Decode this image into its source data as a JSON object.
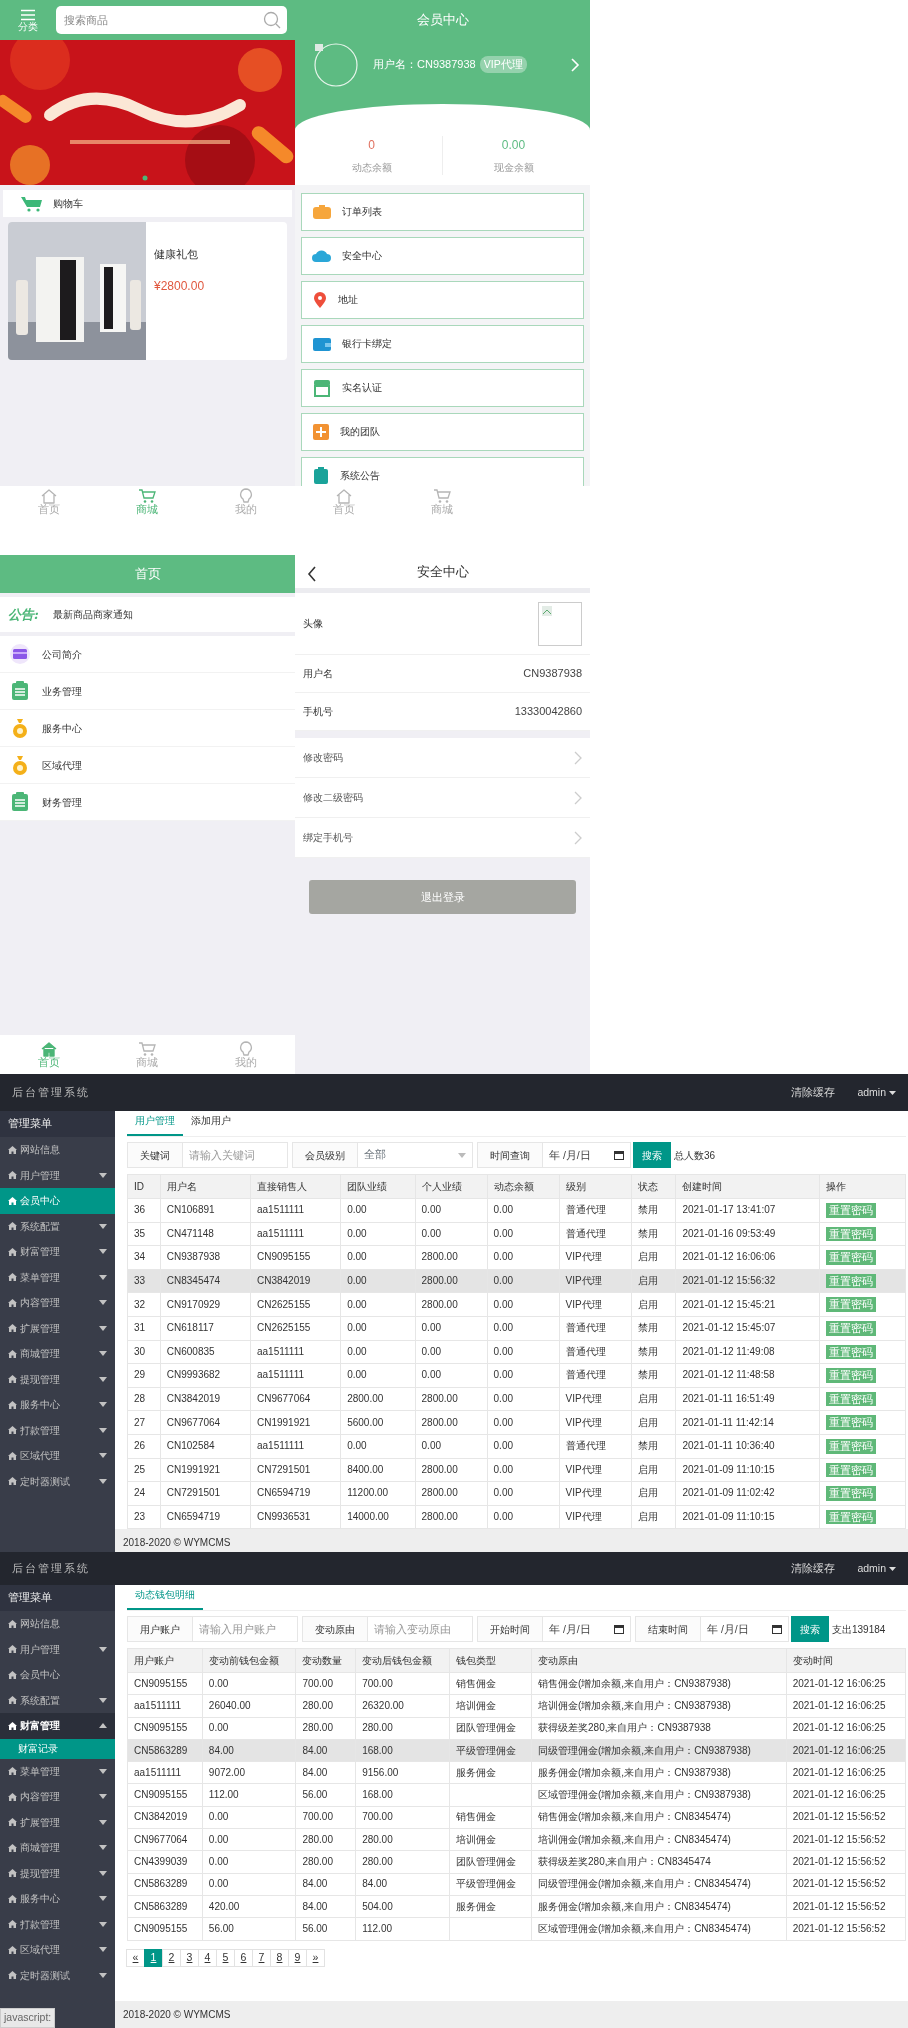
{
  "mall_screen": {
    "menu_label": "分类",
    "search": {
      "placeholder": "搜索商品"
    },
    "cart_label": "购物车",
    "products": [
      {
        "name": "健康礼包",
        "price": "¥2800.00"
      }
    ],
    "tab_bar": [
      {
        "label": "首页",
        "selected": false
      },
      {
        "label": "商城",
        "selected": true
      },
      {
        "label": "我的",
        "selected": false
      }
    ]
  },
  "member_screen": {
    "title": "会员中心",
    "username": "用户名：CN9387938",
    "badge": "VIP代理",
    "balances": [
      {
        "value": "0",
        "label": "动态余额",
        "color": "#e0705f"
      },
      {
        "value": "0.00",
        "label": "现金余额",
        "color": "#5dbb82"
      }
    ],
    "menu": [
      "订单列表",
      "安全中心",
      "地址",
      "银行卡绑定",
      "实名认证",
      "我的团队",
      "系统公告"
    ],
    "tab_bar": [
      {
        "label": "首页",
        "selected": false
      },
      {
        "label": "商城",
        "selected": false
      }
    ]
  },
  "home_screen": {
    "title": "首页",
    "notice_label": "公告:",
    "notice_text": "最新商品商家通知",
    "menu": [
      "公司简介",
      "业务管理",
      "服务中心",
      "区域代理",
      "财务管理"
    ],
    "tab_bar": [
      {
        "label": "首页",
        "selected": true
      },
      {
        "label": "商城",
        "selected": false
      },
      {
        "label": "我的",
        "selected": false
      }
    ]
  },
  "security_screen": {
    "title": "安全中心",
    "rows": [
      {
        "kind": "avatar",
        "label": "头像"
      },
      {
        "kind": "value",
        "label": "用户名",
        "value": "CN9387938"
      },
      {
        "kind": "value",
        "label": "手机号",
        "value": "13330042860"
      },
      {
        "kind": "link",
        "label": "修改密码"
      },
      {
        "kind": "link",
        "label": "修改二级密码"
      },
      {
        "kind": "link",
        "label": "绑定手机号"
      }
    ],
    "logout": "退出登录"
  },
  "user_admin": {
    "brand": "后台管理系统",
    "header_links": [
      "清除缓存",
      "admin"
    ],
    "sidebar": {
      "title": "管理菜单",
      "items": [
        {
          "label": "网站信息",
          "kind": "link",
          "selected": false
        },
        {
          "label": "用户管理",
          "kind": "group",
          "expanded": false,
          "selected": false
        },
        {
          "label": "会员中心",
          "kind": "link",
          "selected": true
        },
        {
          "label": "系统配置",
          "kind": "group",
          "expanded": false,
          "selected": false
        },
        {
          "label": "财富管理",
          "kind": "group",
          "expanded": false,
          "selected": false
        },
        {
          "label": "菜单管理",
          "kind": "group",
          "expanded": false,
          "selected": false
        },
        {
          "label": "内容管理",
          "kind": "group",
          "expanded": false,
          "selected": false
        },
        {
          "label": "扩展管理",
          "kind": "group",
          "expanded": false,
          "selected": false
        },
        {
          "label": "商城管理",
          "kind": "group",
          "expanded": false,
          "selected": false
        },
        {
          "label": "提现管理",
          "kind": "group",
          "expanded": false,
          "selected": false
        },
        {
          "label": "服务中心",
          "kind": "group",
          "expanded": false,
          "selected": false
        },
        {
          "label": "打款管理",
          "kind": "group",
          "expanded": false,
          "selected": false
        },
        {
          "label": "区域代理",
          "kind": "group",
          "expanded": false,
          "selected": false
        },
        {
          "label": "定时器测试",
          "kind": "group",
          "expanded": false,
          "selected": false
        }
      ]
    },
    "tabs": [
      {
        "label": "用户管理",
        "selected": true
      },
      {
        "label": "添加用户",
        "selected": false
      }
    ],
    "filters": [
      {
        "kind": "text",
        "label": "关键词",
        "placeholder": "请输入关键词"
      },
      {
        "kind": "select",
        "label": "会员级别",
        "value": "全部"
      },
      {
        "kind": "date",
        "label": "时间查询",
        "placeholder": "年 /月/日"
      }
    ],
    "search_button": "搜索",
    "summary": "总人数36",
    "table": {
      "columns": [
        "ID",
        "用户名",
        "直接销售人",
        "团队业绩",
        "个人业绩",
        "动态余额",
        "级别",
        "状态",
        "创建时间",
        "操作"
      ],
      "rows": [
        {
          "cells": [
            "36",
            "CN106891",
            "aa1511111",
            "0.00",
            "0.00",
            "0.00",
            "普通代理",
            "禁用",
            "2021-01-17 13:41:07"
          ],
          "action": "重置密码",
          "highlighted": false
        },
        {
          "cells": [
            "35",
            "CN471148",
            "aa1511111",
            "0.00",
            "0.00",
            "0.00",
            "普通代理",
            "禁用",
            "2021-01-16 09:53:49"
          ],
          "action": "重置密码",
          "highlighted": false
        },
        {
          "cells": [
            "34",
            "CN9387938",
            "CN9095155",
            "0.00",
            "2800.00",
            "0.00",
            "VIP代理",
            "启用",
            "2021-01-12 16:06:06"
          ],
          "action": "重置密码",
          "highlighted": false
        },
        {
          "cells": [
            "33",
            "CN8345474",
            "CN3842019",
            "0.00",
            "2800.00",
            "0.00",
            "VIP代理",
            "启用",
            "2021-01-12 15:56:32"
          ],
          "action": "重置密码",
          "highlighted": true
        },
        {
          "cells": [
            "32",
            "CN9170929",
            "CN2625155",
            "0.00",
            "2800.00",
            "0.00",
            "VIP代理",
            "启用",
            "2021-01-12 15:45:21"
          ],
          "action": "重置密码",
          "highlighted": false
        },
        {
          "cells": [
            "31",
            "CN618117",
            "CN2625155",
            "0.00",
            "0.00",
            "0.00",
            "普通代理",
            "禁用",
            "2021-01-12 15:45:07"
          ],
          "action": "重置密码",
          "highlighted": false
        },
        {
          "cells": [
            "30",
            "CN600835",
            "aa1511111",
            "0.00",
            "0.00",
            "0.00",
            "普通代理",
            "禁用",
            "2021-01-12 11:49:08"
          ],
          "action": "重置密码",
          "highlighted": false
        },
        {
          "cells": [
            "29",
            "CN9993682",
            "aa1511111",
            "0.00",
            "0.00",
            "0.00",
            "普通代理",
            "禁用",
            "2021-01-12 11:48:58"
          ],
          "action": "重置密码",
          "highlighted": false
        },
        {
          "cells": [
            "28",
            "CN3842019",
            "CN9677064",
            "2800.00",
            "2800.00",
            "0.00",
            "VIP代理",
            "启用",
            "2021-01-11 16:51:49"
          ],
          "action": "重置密码",
          "highlighted": false
        },
        {
          "cells": [
            "27",
            "CN9677064",
            "CN1991921",
            "5600.00",
            "2800.00",
            "0.00",
            "VIP代理",
            "启用",
            "2021-01-11 11:42:14"
          ],
          "action": "重置密码",
          "highlighted": false
        },
        {
          "cells": [
            "26",
            "CN102584",
            "aa1511111",
            "0.00",
            "0.00",
            "0.00",
            "普通代理",
            "禁用",
            "2021-01-11 10:36:40"
          ],
          "action": "重置密码",
          "highlighted": false
        },
        {
          "cells": [
            "25",
            "CN1991921",
            "CN7291501",
            "8400.00",
            "2800.00",
            "0.00",
            "VIP代理",
            "启用",
            "2021-01-09 11:10:15"
          ],
          "action": "重置密码",
          "highlighted": false
        },
        {
          "cells": [
            "24",
            "CN7291501",
            "CN6594719",
            "11200.00",
            "2800.00",
            "0.00",
            "VIP代理",
            "启用",
            "2021-01-09 11:02:42"
          ],
          "action": "重置密码",
          "highlighted": false
        },
        {
          "cells": [
            "23",
            "CN6594719",
            "CN9936531",
            "14000.00",
            "2800.00",
            "0.00",
            "VIP代理",
            "启用",
            "2021-01-09 11:10:15"
          ],
          "action": "重置密码",
          "highlighted": false
        }
      ]
    },
    "footer": "2018-2020 © WYMCMS"
  },
  "wallet_admin": {
    "brand": "后台管理系统",
    "header_links": [
      "清除缓存",
      "admin"
    ],
    "sidebar": {
      "title": "管理菜单",
      "items": [
        {
          "label": "网站信息",
          "kind": "link",
          "selected": false
        },
        {
          "label": "用户管理",
          "kind": "group",
          "expanded": false,
          "selected": false
        },
        {
          "label": "会员中心",
          "kind": "link",
          "selected": false
        },
        {
          "label": "系统配置",
          "kind": "group",
          "expanded": false,
          "selected": false
        },
        {
          "label": "财富管理",
          "kind": "group",
          "expanded": true,
          "selected": false,
          "children": [
            {
              "label": "财富记录",
              "selected": true
            }
          ]
        },
        {
          "label": "菜单管理",
          "kind": "group",
          "expanded": false,
          "selected": false
        },
        {
          "label": "内容管理",
          "kind": "group",
          "expanded": false,
          "selected": false
        },
        {
          "label": "扩展管理",
          "kind": "group",
          "expanded": false,
          "selected": false
        },
        {
          "label": "商城管理",
          "kind": "group",
          "expanded": false,
          "selected": false
        },
        {
          "label": "提现管理",
          "kind": "group",
          "expanded": false,
          "selected": false
        },
        {
          "label": "服务中心",
          "kind": "group",
          "expanded": false,
          "selected": false
        },
        {
          "label": "打款管理",
          "kind": "group",
          "expanded": false,
          "selected": false
        },
        {
          "label": "区域代理",
          "kind": "group",
          "expanded": false,
          "selected": false
        },
        {
          "label": "定时器测试",
          "kind": "group",
          "expanded": false,
          "selected": false
        }
      ]
    },
    "tabs": [
      {
        "label": "动态钱包明细",
        "selected": true
      }
    ],
    "filters": [
      {
        "kind": "text",
        "label": "用户账户",
        "placeholder": "请输入用户账户"
      },
      {
        "kind": "text",
        "label": "变动原由",
        "placeholder": "请输入变动原由"
      },
      {
        "kind": "date",
        "label": "开始时间",
        "placeholder": "年 /月/日"
      },
      {
        "kind": "date",
        "label": "结束时间",
        "placeholder": "年 /月/日"
      }
    ],
    "search_button": "搜索",
    "summary": "支出139184",
    "table": {
      "columns": [
        "用户账户",
        "变动前钱包金额",
        "变动数量",
        "变动后钱包金额",
        "钱包类型",
        "变动原由",
        "变动时间"
      ],
      "rows": [
        {
          "account": "CN9095155",
          "before": "0.00",
          "amount": "700.00",
          "after": "700.00",
          "wallet_type": "销售佣金",
          "reason": "销售佣金(增加余额,来自用户：CN9387938)",
          "time": "2021-01-12 16:06:25",
          "highlighted": false
        },
        {
          "account": "aa1511111",
          "before": "26040.00",
          "amount": "280.00",
          "after": "26320.00",
          "wallet_type": "培训佣金",
          "reason": "培训佣金(增加余额,来自用户：CN9387938)",
          "time": "2021-01-12 16:06:25",
          "highlighted": false
        },
        {
          "account": "CN9095155",
          "before": "0.00",
          "amount": "280.00",
          "after": "280.00",
          "wallet_type": "团队管理佣金",
          "reason": "获得级差奖280,来自用户：CN9387938",
          "time": "2021-01-12 16:06:25",
          "highlighted": false
        },
        {
          "account": "CN5863289",
          "before": "84.00",
          "amount": "84.00",
          "after": "168.00",
          "wallet_type": "平级管理佣金",
          "reason": "同级管理佣金(增加余额,来自用户：CN9387938)",
          "time": "2021-01-12 16:06:25",
          "highlighted": true
        },
        {
          "account": "aa1511111",
          "before": "9072.00",
          "amount": "84.00",
          "after": "9156.00",
          "wallet_type": "服务佣金",
          "reason": "服务佣金(增加余额,来自用户：CN9387938)",
          "time": "2021-01-12 16:06:25",
          "highlighted": false
        },
        {
          "account": "CN9095155",
          "before": "112.00",
          "amount": "56.00",
          "after": "168.00",
          "reason": "区域管理佣金(增加余额,来自用户：CN9387938)",
          "time": "2021-01-12 16:06:25",
          "highlighted": false
        },
        {
          "account": "CN3842019",
          "before": "0.00",
          "amount": "700.00",
          "after": "700.00",
          "wallet_type": "销售佣金",
          "reason": "销售佣金(增加余额,来自用户：CN8345474)",
          "time": "2021-01-12 15:56:52",
          "highlighted": false
        },
        {
          "account": "CN9677064",
          "before": "0.00",
          "amount": "280.00",
          "after": "280.00",
          "wallet_type": "培训佣金",
          "reason": "培训佣金(增加余额,来自用户：CN8345474)",
          "time": "2021-01-12 15:56:52",
          "highlighted": false
        },
        {
          "account": "CN4399039",
          "before": "0.00",
          "amount": "280.00",
          "after": "280.00",
          "wallet_type": "团队管理佣金",
          "reason": "获得级差奖280,来自用户：CN8345474",
          "time": "2021-01-12 15:56:52",
          "highlighted": false
        },
        {
          "account": "CN5863289",
          "before": "0.00",
          "amount": "84.00",
          "after": "84.00",
          "wallet_type": "平级管理佣金",
          "reason": "同级管理佣金(增加余额,来自用户：CN8345474)",
          "time": "2021-01-12 15:56:52",
          "highlighted": false
        },
        {
          "account": "CN5863289",
          "before": "420.00",
          "amount": "84.00",
          "after": "504.00",
          "wallet_type": "服务佣金",
          "reason": "服务佣金(增加余额,来自用户：CN8345474)",
          "time": "2021-01-12 15:56:52",
          "highlighted": false
        },
        {
          "account": "CN9095155",
          "before": "56.00",
          "amount": "56.00",
          "after": "112.00",
          "reason": "区域管理佣金(增加余额,来自用户：CN8345474)",
          "time": "2021-01-12 15:56:52",
          "highlighted": false
        }
      ]
    },
    "pagination": [
      {
        "label": "«",
        "selected": false
      },
      {
        "label": "1",
        "selected": true
      },
      {
        "label": "2",
        "selected": false
      },
      {
        "label": "3",
        "selected": false
      },
      {
        "label": "4",
        "selected": false
      },
      {
        "label": "5",
        "selected": false
      },
      {
        "label": "6",
        "selected": false
      },
      {
        "label": "7",
        "selected": false
      },
      {
        "label": "8",
        "selected": false
      },
      {
        "label": "9",
        "selected": false
      },
      {
        "label": "»",
        "selected": false
      }
    ],
    "footer": "2018-2020 © WYMCMS",
    "status_hint": "javascript:"
  }
}
